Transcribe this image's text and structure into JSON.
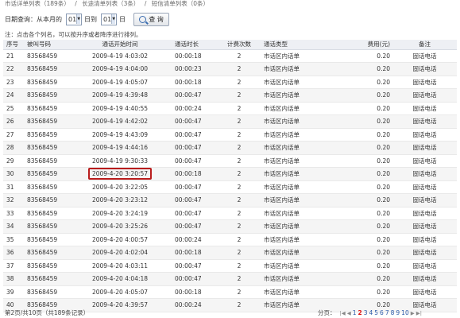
{
  "topbar": {
    "items": [
      "市话详单列表（189条）",
      "/",
      "长途清单列表（3条）",
      "/",
      "短信清单列表（0条）"
    ]
  },
  "query": {
    "label_date": "日期查询：从本月的",
    "day_from": "01",
    "label_to": "日到",
    "day_to": "01",
    "label_day": "日",
    "button": "查 询"
  },
  "note": "注：点击各个列名，可以按升序或者降序进行排列。",
  "table": {
    "headers": [
      "序号",
      "被叫号码",
      "通话开始时间",
      "通话时长",
      "计费次数",
      "通话类型",
      "",
      "费用(元)",
      "备注"
    ],
    "highlighted_row": 9,
    "rows": [
      [
        "21",
        "83568459",
        "2009-4-19 4:03:02",
        "00:00:18",
        "2",
        "市话区内话单",
        "",
        "0.20",
        "固话电话"
      ],
      [
        "22",
        "83568459",
        "2009-4-19 4:04:00",
        "00:00:23",
        "2",
        "市话区内话单",
        "",
        "0.20",
        "固话电话"
      ],
      [
        "23",
        "83568459",
        "2009-4-19 4:05:07",
        "00:00:18",
        "2",
        "市话区内话单",
        "",
        "0.20",
        "固话电话"
      ],
      [
        "24",
        "83568459",
        "2009-4-19 4:39:48",
        "00:00:47",
        "2",
        "市话区内话单",
        "",
        "0.20",
        "固话电话"
      ],
      [
        "25",
        "83568459",
        "2009-4-19 4:40:55",
        "00:00:24",
        "2",
        "市话区内话单",
        "",
        "0.20",
        "固话电话"
      ],
      [
        "26",
        "83568459",
        "2009-4-19 4:42:02",
        "00:00:47",
        "2",
        "市话区内话单",
        "",
        "0.20",
        "固话电话"
      ],
      [
        "27",
        "83568459",
        "2009-4-19 4:43:09",
        "00:00:47",
        "2",
        "市话区内话单",
        "",
        "0.20",
        "固话电话"
      ],
      [
        "28",
        "83568459",
        "2009-4-19 4:44:16",
        "00:00:47",
        "2",
        "市话区内话单",
        "",
        "0.20",
        "固话电话"
      ],
      [
        "29",
        "83568459",
        "2009-4-19 9:30:33",
        "00:00:47",
        "2",
        "市话区内话单",
        "",
        "0.20",
        "固话电话"
      ],
      [
        "30",
        "83568459",
        "2009-4-20 3:20:57",
        "00:00:18",
        "2",
        "市话区内话单",
        "",
        "0.20",
        "固话电话"
      ],
      [
        "31",
        "83568459",
        "2009-4-20 3:22:05",
        "00:00:47",
        "2",
        "市话区内话单",
        "",
        "0.20",
        "固话电话"
      ],
      [
        "32",
        "83568459",
        "2009-4-20 3:23:12",
        "00:00:47",
        "2",
        "市话区内话单",
        "",
        "0.20",
        "固话电话"
      ],
      [
        "33",
        "83568459",
        "2009-4-20 3:24:19",
        "00:00:47",
        "2",
        "市话区内话单",
        "",
        "0.20",
        "固话电话"
      ],
      [
        "34",
        "83568459",
        "2009-4-20 3:25:26",
        "00:00:47",
        "2",
        "市话区内话单",
        "",
        "0.20",
        "固话电话"
      ],
      [
        "35",
        "83568459",
        "2009-4-20 4:00:57",
        "00:00:24",
        "2",
        "市话区内话单",
        "",
        "0.20",
        "固话电话"
      ],
      [
        "36",
        "83568459",
        "2009-4-20 4:02:04",
        "00:00:18",
        "2",
        "市话区内话单",
        "",
        "0.20",
        "固话电话"
      ],
      [
        "37",
        "83568459",
        "2009-4-20 4:03:11",
        "00:00:47",
        "2",
        "市话区内话单",
        "",
        "0.20",
        "固话电话"
      ],
      [
        "38",
        "83568459",
        "2009-4-20 4:04:18",
        "00:00:47",
        "2",
        "市话区内话单",
        "",
        "0.20",
        "固话电话"
      ],
      [
        "39",
        "83568459",
        "2009-4-20 4:05:07",
        "00:00:18",
        "2",
        "市话区内话单",
        "",
        "0.20",
        "固话电话"
      ],
      [
        "40",
        "83568459",
        "2009-4-20 4:39:57",
        "00:00:24",
        "2",
        "市话区内话单",
        "",
        "0.20",
        "固话电话"
      ]
    ]
  },
  "footer": {
    "status": "第2页/共10页（共189条记录）",
    "pager_label": "分页：",
    "nav_first": "|◀",
    "nav_prev": "◀",
    "nav_next": "▶",
    "nav_last": "▶|",
    "pages": [
      "1",
      "2",
      "3",
      "4",
      "5",
      "6",
      "7",
      "8",
      "9",
      "10"
    ],
    "current_page": "2"
  }
}
